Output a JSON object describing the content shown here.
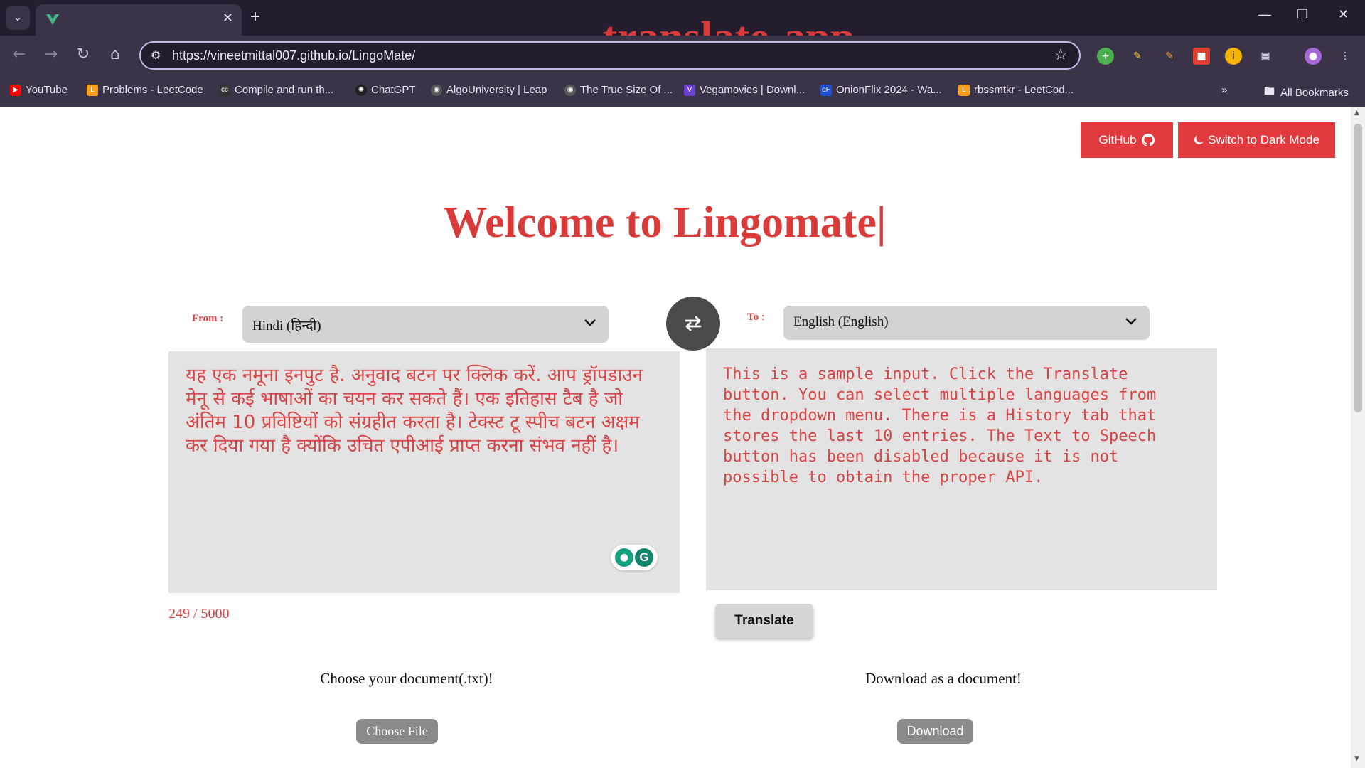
{
  "browser": {
    "tab_title": "translate-app",
    "url": "https://vineetmittal007.github.io/LingoMate/",
    "bookmarks": [
      {
        "label": "YouTube",
        "icon": "youtube-icon",
        "color": "#ff0000"
      },
      {
        "label": "Problems - LeetCode",
        "icon": "leetcode-icon",
        "color": "#ffa116"
      },
      {
        "label": "Compile and run th...",
        "icon": "cc-icon",
        "color": "#333333"
      },
      {
        "label": "ChatGPT",
        "icon": "chatgpt-icon",
        "color": "#202020"
      },
      {
        "label": "AlgoUniversity | Leap",
        "icon": "globe-icon",
        "color": "#5a5a5a"
      },
      {
        "label": "The True Size Of ...",
        "icon": "globe-icon",
        "color": "#5a5a5a"
      },
      {
        "label": "Vegamovies | Downl...",
        "icon": "vegamovies-icon",
        "color": "#6a3fd1"
      },
      {
        "label": "OnionFlix 2024 - Wa...",
        "icon": "onionflix-icon",
        "color": "#1d4ed8"
      },
      {
        "label": "rbssmtkr - LeetCod...",
        "icon": "leetcode-icon",
        "color": "#ffa116"
      }
    ],
    "all_bookmarks": "All Bookmarks"
  },
  "header": {
    "github_label": "GitHub",
    "dark_mode_label": "Switch to Dark Mode",
    "accent_color": "#e0393e"
  },
  "main": {
    "title": "Welcome to Lingomate|",
    "from_label": "From :",
    "to_label": "To :",
    "from_language": "Hindi (हिन्दी)",
    "to_language": "English (English)",
    "source_text": "यह एक नमूना इनपुट है. अनुवाद बटन पर क्लिक करें. आप ड्रॉपडाउन मेनू से कई भाषाओं का चयन कर सकते हैं। एक इतिहास टैब है जो अंतिम 10 प्रविष्टियों को संग्रहीत करता है। टेक्स्ट टू स्पीच बटन अक्षम कर दिया गया है क्योंकि उचित एपीआई प्राप्त करना संभव नहीं है।",
    "output_text": "This is a sample input. Click the Translate\nbutton. You can select multiple languages from\nthe dropdown menu. There is a History tab that\nstores the last 10 entries. The Text to Speech\nbutton has been disabled because it is not\npossible to obtain the proper API.",
    "char_count": "249 / 5000",
    "translate_label": "Translate",
    "upload_caption": "Choose your document(.txt)!",
    "choose_file_label": "Choose File",
    "download_caption": "Download as a document!",
    "download_label": "Download"
  }
}
